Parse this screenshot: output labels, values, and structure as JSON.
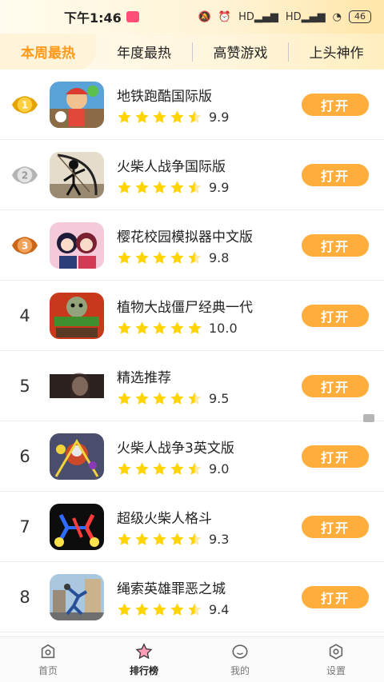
{
  "status": {
    "time": "下午1:46",
    "network_1": "HD",
    "network_2": "HD",
    "battery": "46"
  },
  "tabs": [
    {
      "label": "本周最热",
      "active": true
    },
    {
      "label": "年度最热",
      "active": false
    },
    {
      "label": "高赞游戏",
      "active": false
    },
    {
      "label": "上头神作",
      "active": false
    }
  ],
  "open_label": "打开",
  "apps": [
    {
      "rank": "1",
      "medal": "gold",
      "name": "地铁跑酷国际版",
      "score": "9.9",
      "stars": 4.5,
      "icon": "subway-surfers-icon"
    },
    {
      "rank": "2",
      "medal": "silver",
      "name": "火柴人战争国际版",
      "score": "9.9",
      "stars": 4.5,
      "icon": "stick-war-icon"
    },
    {
      "rank": "3",
      "medal": "bronze",
      "name": "樱花校园模拟器中文版",
      "score": "9.8",
      "stars": 4.5,
      "icon": "sakura-school-icon"
    },
    {
      "rank": "4",
      "medal": "",
      "name": "植物大战僵尸经典一代",
      "score": "10.0",
      "stars": 5,
      "icon": "plants-vs-zombies-icon"
    },
    {
      "rank": "5",
      "medal": "",
      "name": "精选推荐",
      "score": "9.5",
      "stars": 4.5,
      "icon": "featured-photo-icon"
    },
    {
      "rank": "6",
      "medal": "",
      "name": "火柴人战争3英文版",
      "score": "9.0",
      "stars": 4.5,
      "icon": "stick-war-3-icon"
    },
    {
      "rank": "7",
      "medal": "",
      "name": "超级火柴人格斗",
      "score": "9.3",
      "stars": 4.5,
      "icon": "stickman-fight-icon"
    },
    {
      "rank": "8",
      "medal": "",
      "name": "绳索英雄罪恶之城",
      "score": "9.4",
      "stars": 4.5,
      "icon": "rope-hero-icon"
    }
  ],
  "nav": [
    {
      "label": "首页",
      "active": false,
      "icon": "home-icon"
    },
    {
      "label": "排行榜",
      "active": true,
      "icon": "ranking-star-icon"
    },
    {
      "label": "我的",
      "active": false,
      "icon": "profile-icon"
    },
    {
      "label": "设置",
      "active": false,
      "icon": "settings-icon"
    }
  ],
  "colors": {
    "accent": "#ffad3d",
    "star": "#ffd400",
    "active_tab": "#ff9a1a"
  }
}
